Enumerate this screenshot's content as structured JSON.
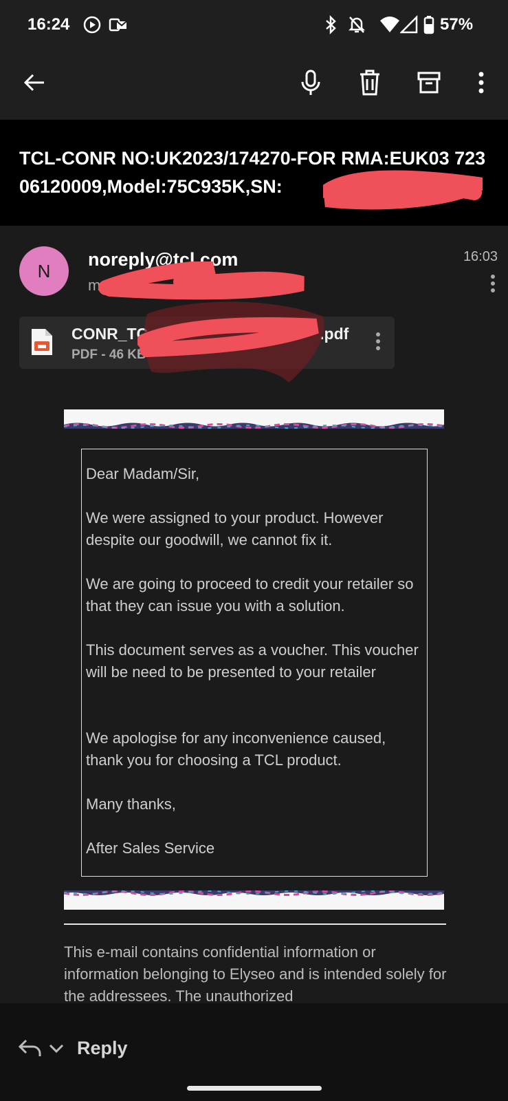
{
  "status_bar": {
    "time": "16:24",
    "battery": "57%",
    "icons": [
      "media-icon",
      "outlook-notification-icon",
      "bluetooth-icon",
      "mute-icon",
      "wifi-icon",
      "signal-icon",
      "battery-icon"
    ]
  },
  "toolbar": {
    "icons": [
      "back-arrow-icon",
      "microphone-icon",
      "delete-icon",
      "archive-icon",
      "more-vert-icon"
    ]
  },
  "subject": "TCL-CONR NO:UK2023/174270-FOR RMA:EUK03 72306120009,Model:75C935K,SN:",
  "message": {
    "avatar_letter": "N",
    "sender": "noreply@tcl.com",
    "recipient_visible": "m",
    "time": "16:03"
  },
  "attachment": {
    "name_start": "CONR_TC",
    "name_end": ".pdf",
    "meta": "PDF - 46 KB"
  },
  "body": {
    "greeting": "Dear Madam/Sir,",
    "para1": "We were assigned to your product. However despite our goodwill, we cannot fix it.",
    "para2": "We are going to proceed to credit your retailer so that they can issue you with a solution.",
    "para3": "This document serves as a voucher. This voucher will be need to be presented to your retailer",
    "para4": "We apologise for any inconvenience caused, thank you for choosing a TCL product.",
    "closing": "Many thanks,",
    "signature": "After Sales Service"
  },
  "footer": "This e-mail contains confidential information or information belonging to Elyseo and is intended solely for the addressees. The unauthorized",
  "reply_bar": {
    "label": "Reply"
  },
  "colors": {
    "redaction": "#f0505a",
    "avatar": "#e07ec0",
    "background": "#1b1b1b"
  }
}
